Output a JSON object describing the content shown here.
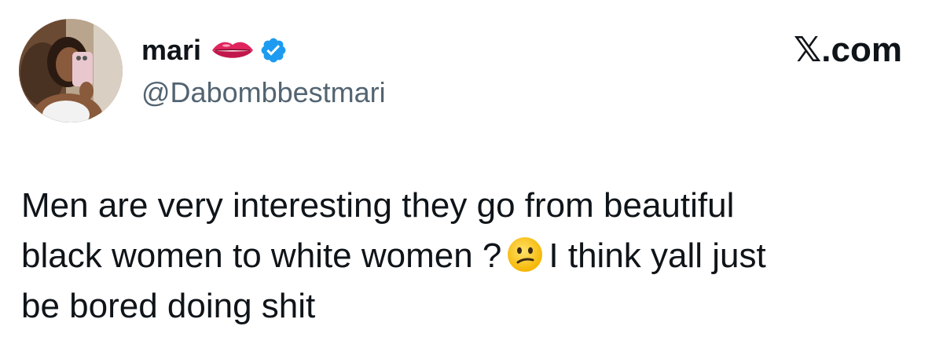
{
  "tweet": {
    "author": {
      "display_name": "mari",
      "handle": "@Dabombbestmari",
      "name_emoji": "lips-icon",
      "verified": true,
      "verified_color": "#1d9bf0"
    },
    "brand": "𝕏.com",
    "text_lines": {
      "line1": "Men are very interesting they go from beautiful",
      "line2_before": "black women to white women ?",
      "line2_emoji": "confused-face-icon",
      "line2_after": "I think yall just",
      "line3": "be bored doing shit"
    }
  }
}
